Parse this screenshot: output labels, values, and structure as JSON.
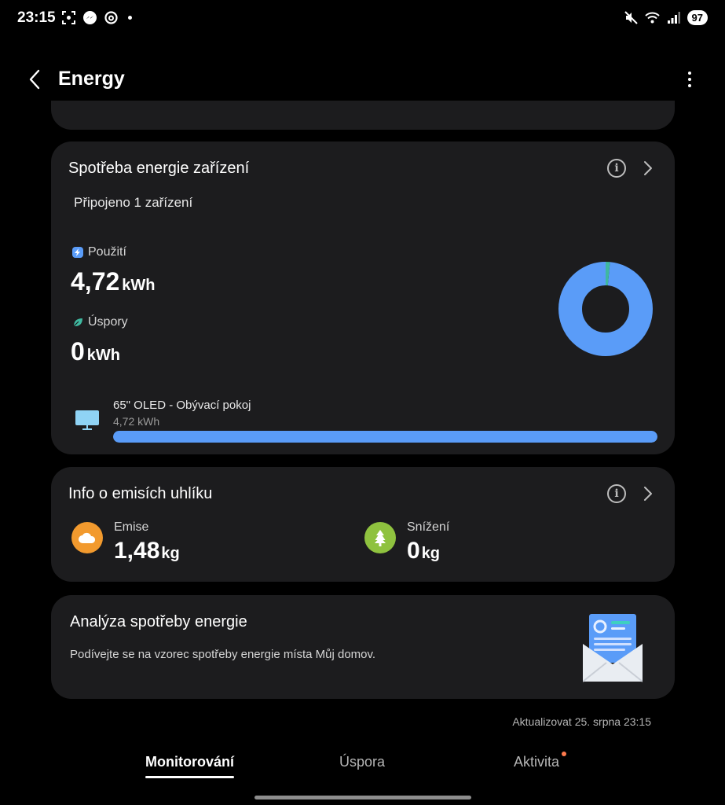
{
  "status_bar": {
    "time": "23:15",
    "battery": "97",
    "icons_left": [
      "screenshot-icon",
      "messenger-icon",
      "threads-icon",
      "notification-dot"
    ],
    "icons_right": [
      "mute-icon",
      "wifi-icon",
      "signal-icon",
      "battery-icon"
    ]
  },
  "header": {
    "title": "Energy"
  },
  "device_energy": {
    "title": "Spotřeba energie zařízení",
    "connected": "Připojeno 1 zařízení",
    "usage_label": "Použití",
    "usage_value": "4,72",
    "usage_unit": "kWh",
    "savings_label": "Úspory",
    "savings_value": "0",
    "savings_unit": "kWh",
    "device": {
      "name": "65\" OLED - Obývací pokoj",
      "value": "4,72 kWh",
      "fraction": 1.0
    },
    "donut_share": {
      "usage": 0.985,
      "savings": 0.015
    },
    "colors": {
      "usage": "#5a9cf8",
      "savings": "#3fb8a0"
    }
  },
  "carbon": {
    "title": "Info o emisích uhlíku",
    "emission_label": "Emise",
    "emission_value": "1,48",
    "emission_unit": "kg",
    "reduction_label": "Snížení",
    "reduction_value": "0",
    "reduction_unit": "kg",
    "colors": {
      "emission": "#f29a2e",
      "reduction": "#8fc23f"
    }
  },
  "analysis": {
    "title": "Analýza spotřeby energie",
    "description": "Podívejte se na vzorec spotřeby energie místa Můj domov."
  },
  "updated": "Aktualizovat 25. srpna 23:15",
  "tabs": [
    {
      "label": "Monitorování",
      "active": true
    },
    {
      "label": "Úspora",
      "active": false
    },
    {
      "label": "Aktivita",
      "active": false,
      "badge": true
    }
  ]
}
